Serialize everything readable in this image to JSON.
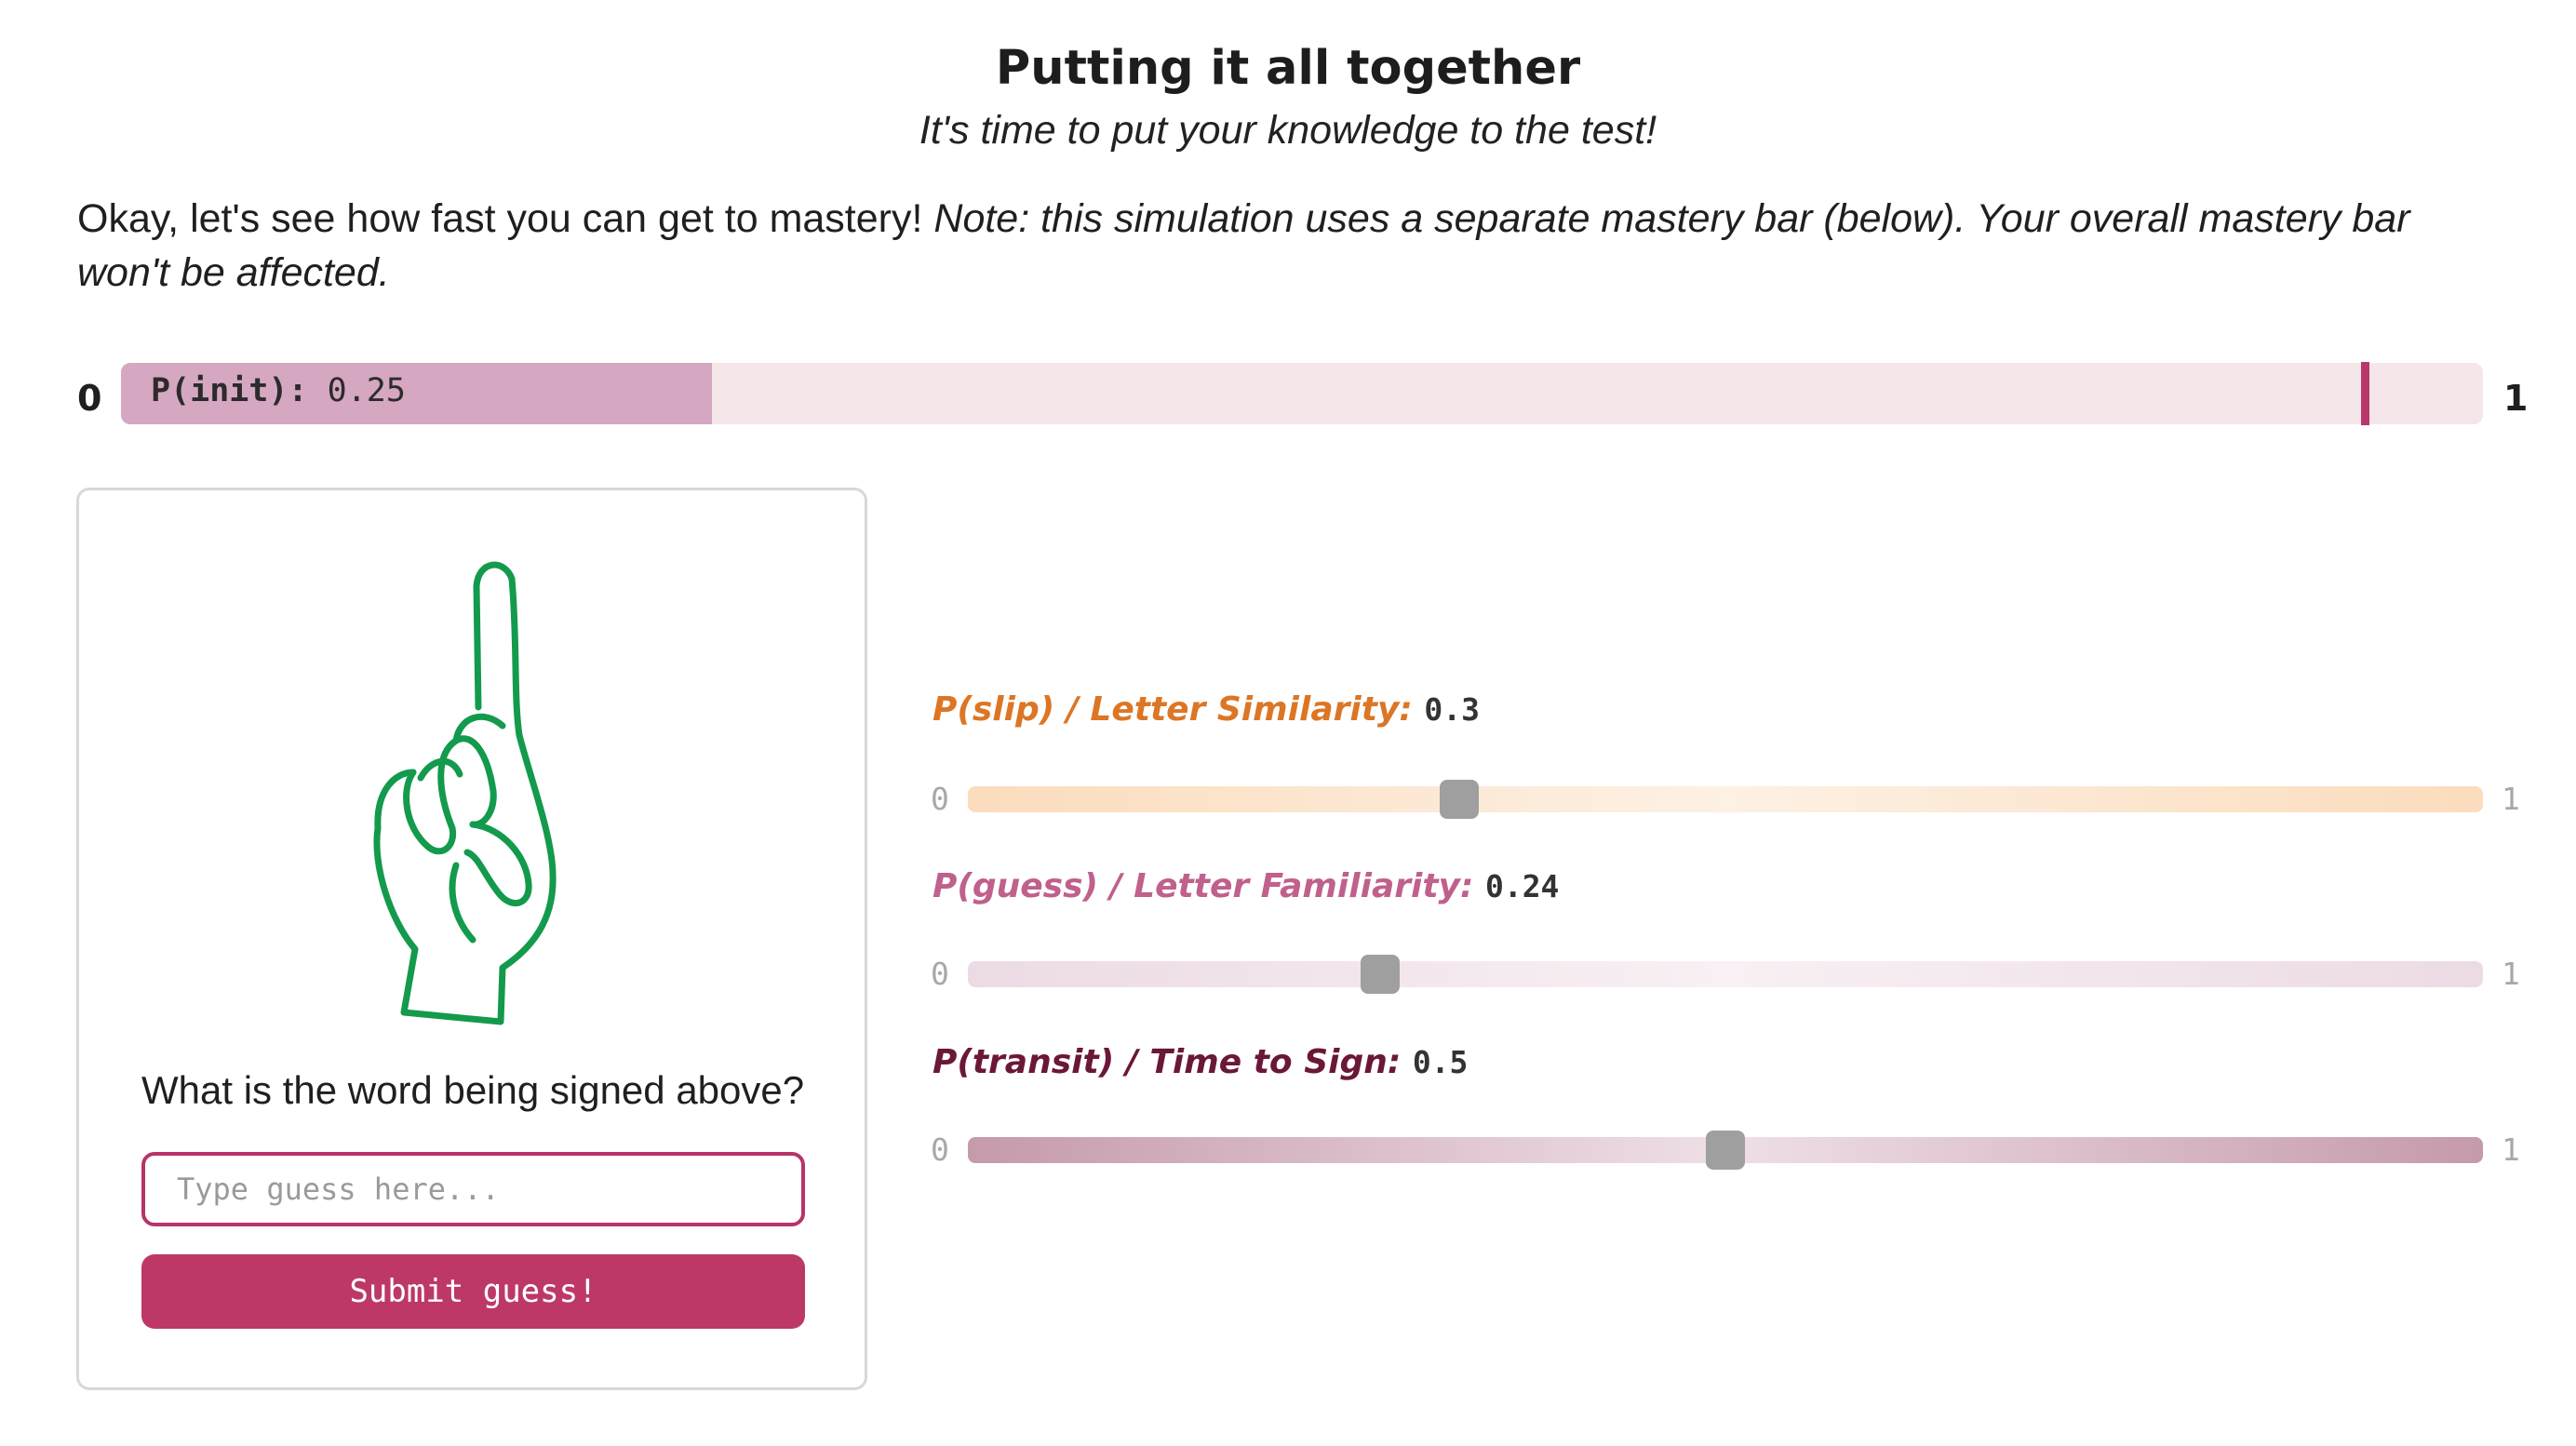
{
  "header": {
    "title": "Putting it all together",
    "subtitle": "It's time to put your knowledge to the test!"
  },
  "intro": {
    "text": "Okay, let's see how fast you can get to mastery! ",
    "note": "Note: this simulation uses a separate mastery bar (below). Your overall mastery bar won't be affected."
  },
  "mastery_bar": {
    "min_label": "0",
    "max_label": "1",
    "label": "P(init):",
    "value_text": "0.25",
    "value": 0.25,
    "threshold": 0.95,
    "fill_color": "#d6a7c0",
    "track_color": "#f5e6e9",
    "threshold_color": "#b9366a"
  },
  "card": {
    "icon": "asl-hand-sign-icon",
    "icon_color": "#139a4d",
    "question": "What is the word being signed above?",
    "input_placeholder": "Type guess here...",
    "submit_label": "Submit guess!",
    "accent_color": "#bd3867"
  },
  "sliders": {
    "slip": {
      "label": "P(slip) / Letter Similarity:",
      "value_text": "0.3",
      "value": 0.3,
      "min": "0",
      "max": "1",
      "color": "#dc7625"
    },
    "guess": {
      "label": "P(guess) / Letter Familiarity:",
      "value_text": "0.24",
      "value": 0.24,
      "min": "0",
      "max": "1",
      "color": "#c0608c"
    },
    "transit": {
      "label": "P(transit) / Time to Sign:",
      "value_text": "0.5",
      "value": 0.5,
      "min": "0",
      "max": "1",
      "color": "#6a1738"
    }
  }
}
